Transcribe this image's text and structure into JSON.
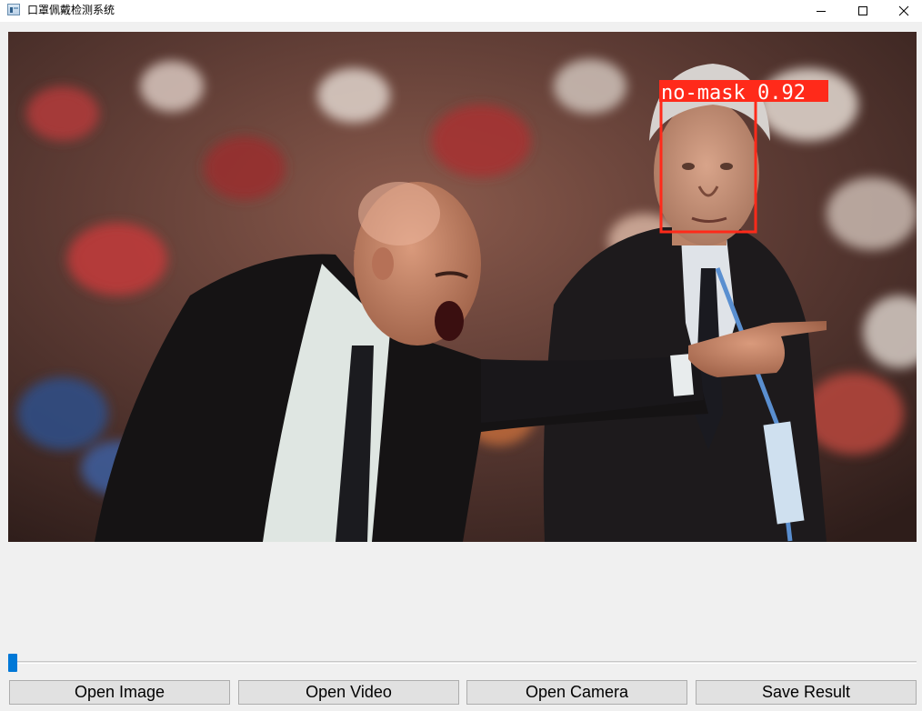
{
  "window": {
    "title": "口罩佩戴检测系统"
  },
  "title_buttons": [
    {
      "name": "minimize-icon"
    },
    {
      "name": "maximize-icon"
    },
    {
      "name": "close-icon"
    }
  ],
  "display": {
    "detections": [
      {
        "label": "no-mask 0.92",
        "box_color": "#ff2a1a"
      }
    ]
  },
  "slider": {
    "value_fraction": 0.0,
    "accent": "#0078d7"
  },
  "buttons": {
    "open_image": "Open Image",
    "open_video": "Open Video",
    "open_camera": "Open Camera",
    "save_result": "Save Result"
  }
}
